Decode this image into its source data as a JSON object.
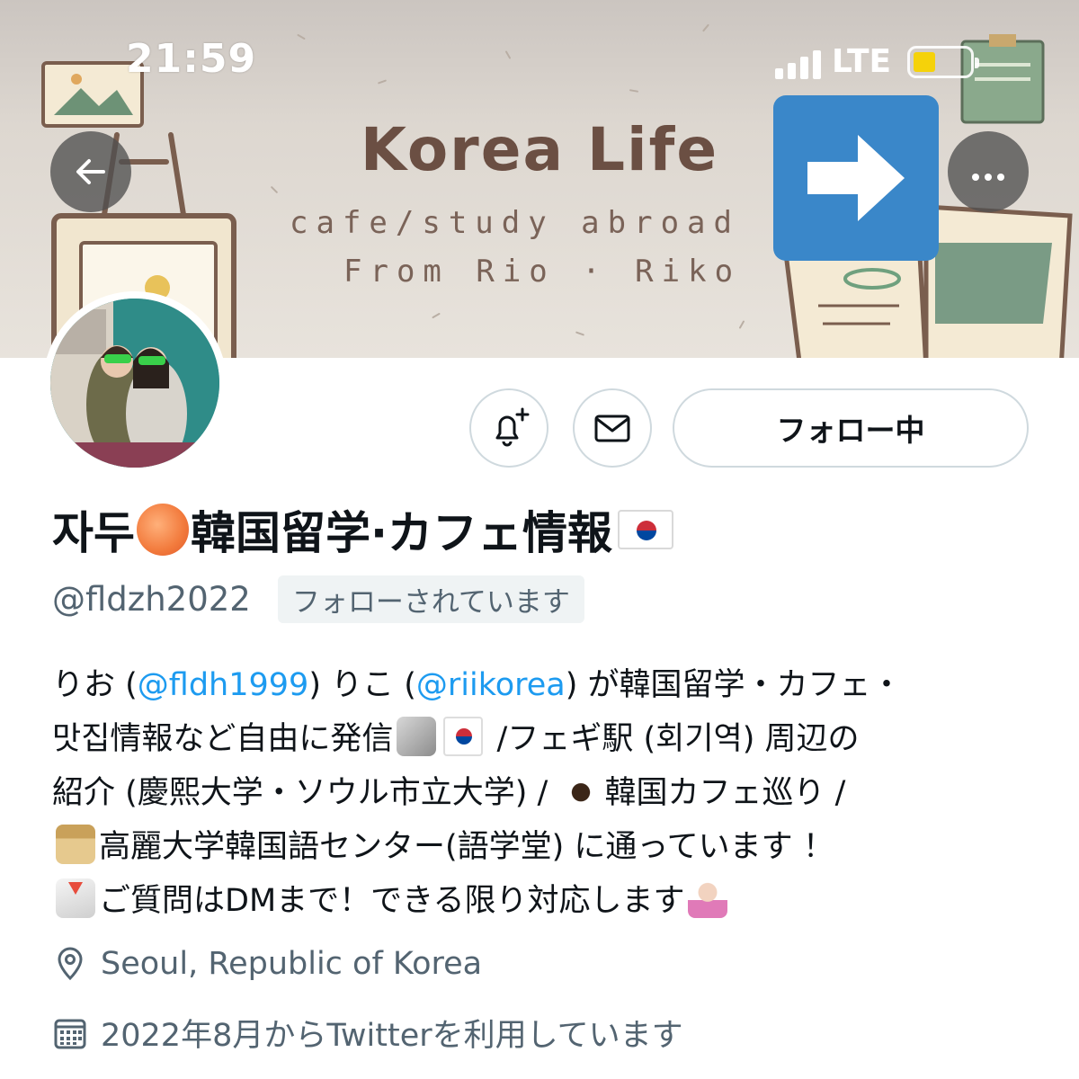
{
  "status_bar": {
    "time": "21:59",
    "network": "LTE",
    "battery_color": "#f5d20a"
  },
  "banner": {
    "title": "Korea Life",
    "line1": "cafe/study abroad",
    "line2": "From Rio · Riko",
    "back_icon": "arrow-left-icon",
    "more_icon": "more-horizontal-icon",
    "overlay_icon": "arrow-right-icon",
    "overlay_color": "#3a87c9"
  },
  "actions": {
    "notify_icon": "bell-plus-icon",
    "message_icon": "mail-icon",
    "follow_label": "フォロー中"
  },
  "profile": {
    "name_part1": "자두",
    "name_part2": "韓国留学·カフェ情報",
    "handle": "@fldzh2022",
    "follows_you": "フォローされています",
    "bio": {
      "l1_a": "りお (",
      "l1_mention1": "@fldh1999",
      "l1_b": ") りこ (",
      "l1_mention2": "@riikorea",
      "l1_c": ") が韓国留学・カフェ・",
      "l2_a": "맛집情報など自由に発信",
      "l2_b": "/フェギ駅 (회기역) 周辺の",
      "l3_a": "紹介 (慶熙大学・ソウル市立大学) / ",
      "l3_b": "韓国カフェ巡り /",
      "l4_a": "高麗大学韓国語センター(語学堂) に通っています ！",
      "l5_a": "ご質問はDMまで！できる限り対応します"
    },
    "location": "Seoul, Republic of Korea",
    "joined": "2022年8月からTwitterを利用しています",
    "location_icon": "map-pin-icon",
    "calendar_icon": "calendar-icon",
    "link_color": "#1d9bf0"
  }
}
